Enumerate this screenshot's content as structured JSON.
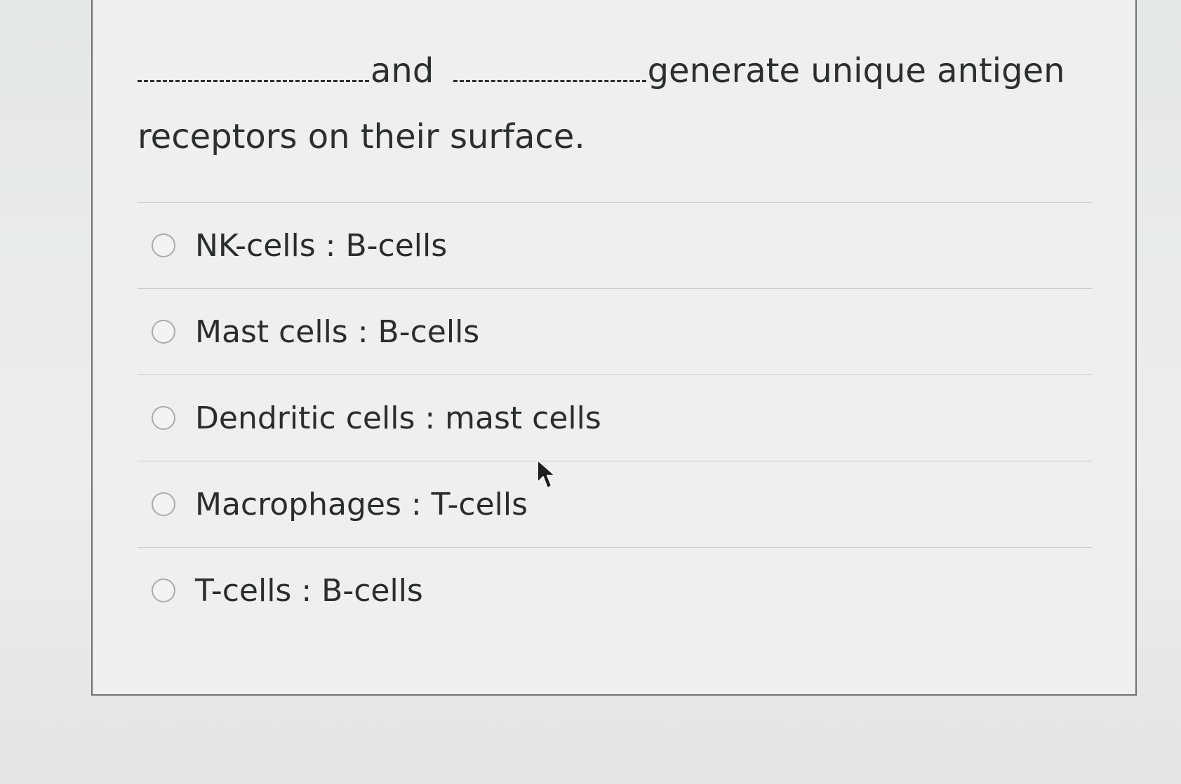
{
  "question": {
    "connector": "and",
    "text_after_blanks": "generate unique antigen receptors on their surface."
  },
  "options": [
    {
      "label": "NK-cells : B-cells",
      "selected": false
    },
    {
      "label": "Mast cells : B-cells",
      "selected": false
    },
    {
      "label": "Dendritic cells : mast cells",
      "selected": false
    },
    {
      "label": "Macrophages : T-cells",
      "selected": false
    },
    {
      "label": "T-cells : B-cells",
      "selected": false
    }
  ],
  "icons": {
    "radio": "radio-unselected-icon",
    "cursor": "mouse-pointer-icon"
  }
}
